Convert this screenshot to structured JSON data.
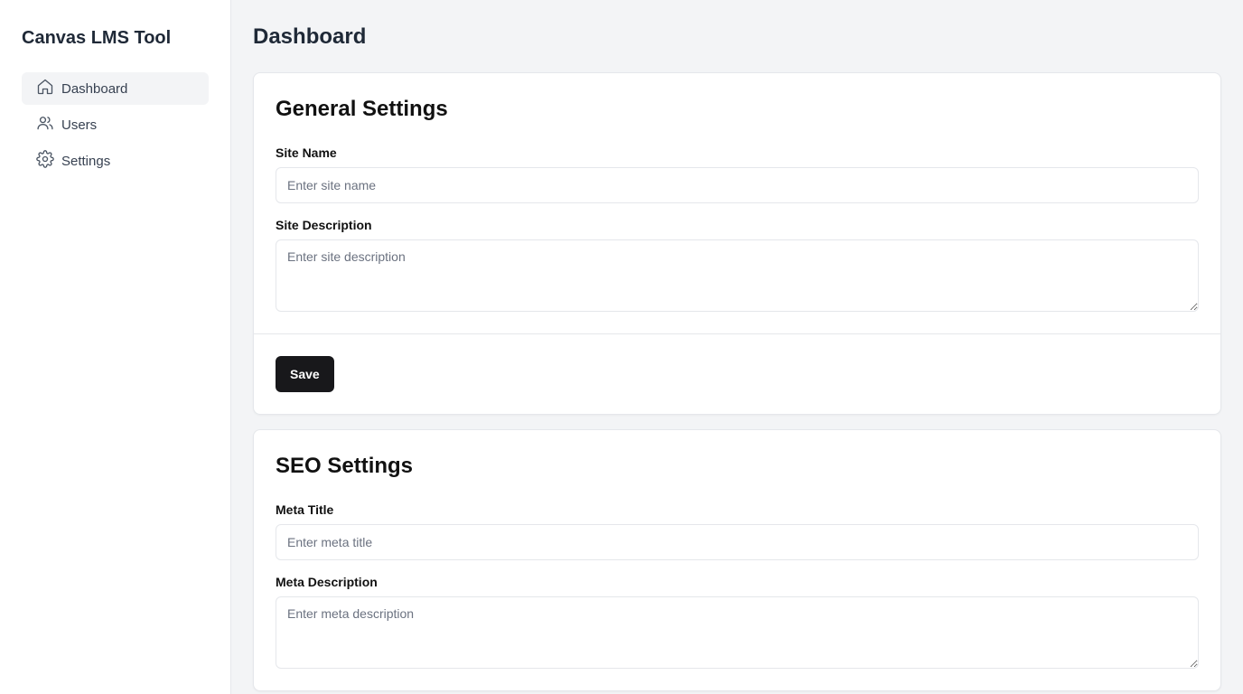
{
  "app": {
    "title": "Canvas LMS Tool"
  },
  "sidebar": {
    "items": [
      {
        "label": "Dashboard",
        "icon": "home-icon",
        "active": true
      },
      {
        "label": "Users",
        "icon": "users-icon",
        "active": false
      },
      {
        "label": "Settings",
        "icon": "gear-icon",
        "active": false
      }
    ]
  },
  "main": {
    "title": "Dashboard",
    "general": {
      "title": "General Settings",
      "site_name_label": "Site Name",
      "site_name_placeholder": "Enter site name",
      "site_name_value": "",
      "site_description_label": "Site Description",
      "site_description_placeholder": "Enter site description",
      "site_description_value": "",
      "save_label": "Save"
    },
    "seo": {
      "title": "SEO Settings",
      "meta_title_label": "Meta Title",
      "meta_title_placeholder": "Enter meta title",
      "meta_title_value": "",
      "meta_description_label": "Meta Description",
      "meta_description_placeholder": "Enter meta description",
      "meta_description_value": ""
    }
  },
  "colors": {
    "sidebar_bg": "#ffffff",
    "main_bg": "#f3f4f6",
    "active_item_bg": "#f3f4f6",
    "button_bg": "#18181b",
    "border": "#e5e7eb"
  }
}
